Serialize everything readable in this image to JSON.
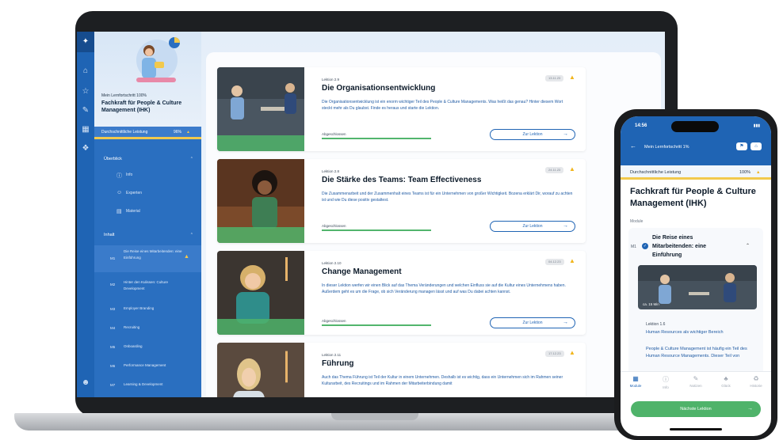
{
  "laptop": {
    "sidebar": {
      "progress_label": "Mein Lernfortschritt 100%",
      "course_title": "Fachkraft für People & Culture Management (IHK)",
      "performance_label": "Durchschnittliche Leistung",
      "performance_value": "96%",
      "overview_label": "Überblick",
      "overview_items": [
        "Info",
        "Experten",
        "Material"
      ],
      "content_label": "Inhalt",
      "modules": [
        {
          "no": "M1",
          "name": "Die Reise eines Mitarbeitenden: eine Einführung"
        },
        {
          "no": "M2",
          "name": "Hinter den Kulissen: Culture Development"
        },
        {
          "no": "M3",
          "name": "Employer Branding"
        },
        {
          "no": "M4",
          "name": "Recruiting"
        },
        {
          "no": "M5",
          "name": "Onboarding"
        },
        {
          "no": "M6",
          "name": "Performance Management"
        },
        {
          "no": "M7",
          "name": "Learning & Development"
        }
      ]
    },
    "lessons": [
      {
        "number": "Lektion 2.9",
        "title": "Die Organisationsentwicklung",
        "date": "13.11.23",
        "description": "Die Organisationsentwicklung ist ein enorm wichtiger Teil des People & Culture Managements. Was heißt das genau? Hinter diesem Wort steckt mehr als Du glaubst. Finde es heraus und starte die Lektion.",
        "status": "Abgeschlossen",
        "button": "Zur Lektion"
      },
      {
        "number": "Lektion 2.8",
        "title": "Die Stärke des Teams: Team Effectiveness",
        "date": "24.11.23",
        "description": "Die Zusammenarbeit und der Zusammenhalt eines Teams ist für ein Unternehmen von großer Wichtigkeit. Bozena erklärt Dir, worauf zu achten ist und wie Du diese positiv gestaltest.",
        "status": "Abgeschlossen",
        "button": "Zur Lektion"
      },
      {
        "number": "Lektion 2.10",
        "title": "Change Management",
        "date": "04.12.23",
        "description": "In dieser Lektion werfen wir einen Blick auf das Thema Veränderungen und welchen Einfluss sie auf die Kultur eines Unternehmens haben. Außerdem geht es um die Frage, ob sich Veränderung managen lässt und auf was Du dabei achten kannst.",
        "status": "Abgeschlossen",
        "button": "Zur Lektion"
      },
      {
        "number": "Lektion 2.11",
        "title": "Führung",
        "date": "17.12.23",
        "description": "Auch das Thema Führung ist Teil der Kultur in einem Unternehmen. Deshalb ist es wichtig, dass ein Unternehmen sich im Rahmen seiner Kulturarbeit, des Recruitings und im Rahmen der Mitarbeiterbindung damit",
        "status": "",
        "button": ""
      }
    ]
  },
  "phone": {
    "time": "14:56",
    "progress_label": "Mein Lernfortschritt 1%",
    "performance_label": "Durchschnittliche Leistung",
    "performance_value": "100%",
    "course_title": "Fachkraft für People & Culture Management (IHK)",
    "module_label": "Module",
    "module_no": "M1",
    "module_name": "Die Reise eines Mitarbeitenden: eine Einführung",
    "duration": "ca. 15 Min",
    "lesson_no": "Lektion 1.6",
    "lesson_title": "Human Resources als wichtiger Bereich",
    "lesson_desc": "People & Culture Management ist häufig ein Teil des Human Resource Managements. Dieser Teil von",
    "nav": [
      "Module",
      "Info",
      "Notizen",
      "Glück",
      "Historie"
    ],
    "next_button": "Nächste Lektion"
  },
  "colors": {
    "primary": "#1f64b4",
    "accent_green": "#4fb36a",
    "star": "#f1b51c"
  }
}
